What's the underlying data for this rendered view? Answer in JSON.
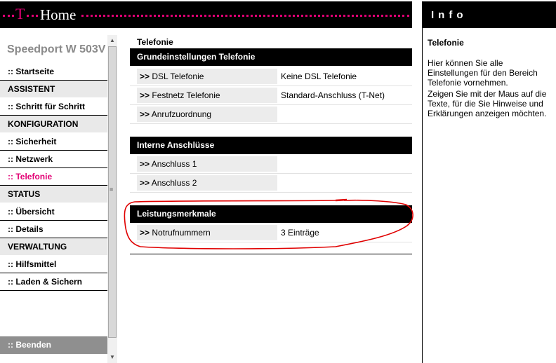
{
  "header": {
    "brand_t": "T",
    "brand_home": "Home"
  },
  "sidebar": {
    "model": "Speedport W 503V",
    "items": [
      {
        "label": ":: Startseite",
        "kind": "link"
      },
      {
        "label": "ASSISTENT",
        "kind": "section"
      },
      {
        "label": ":: Schritt für Schritt",
        "kind": "link"
      },
      {
        "label": "KONFIGURATION",
        "kind": "section"
      },
      {
        "label": ":: Sicherheit",
        "kind": "link"
      },
      {
        "label": ":: Netzwerk",
        "kind": "link"
      },
      {
        "label": ":: Telefonie",
        "kind": "link",
        "active": true
      },
      {
        "label": "STATUS",
        "kind": "section"
      },
      {
        "label": ":: Übersicht",
        "kind": "link"
      },
      {
        "label": ":: Details",
        "kind": "link"
      },
      {
        "label": "VERWALTUNG",
        "kind": "section"
      },
      {
        "label": ":: Hilfsmittel",
        "kind": "link"
      },
      {
        "label": ":: Laden & Sichern",
        "kind": "link"
      }
    ],
    "logout": ":: Beenden"
  },
  "main": {
    "title": "Telefonie",
    "sections": [
      {
        "heading": "Grundeinstellungen Telefonie",
        "rows": [
          {
            "arrow": ">>",
            "label": "DSL Telefonie",
            "value": "Keine DSL Telefonie"
          },
          {
            "arrow": ">>",
            "label": "Festnetz Telefonie",
            "value": "Standard-Anschluss (T-Net)"
          },
          {
            "arrow": ">>",
            "label": "Anrufzuordnung",
            "value": ""
          }
        ]
      },
      {
        "heading": "Interne Anschlüsse",
        "rows": [
          {
            "arrow": ">>",
            "label": "Anschluss 1",
            "value": ""
          },
          {
            "arrow": ">>",
            "label": "Anschluss 2",
            "value": ""
          }
        ]
      },
      {
        "heading": "Leistungsmerkmale",
        "rows": [
          {
            "arrow": ">>",
            "label": "Notrufnummern",
            "value": "3 Einträge"
          }
        ]
      }
    ]
  },
  "info": {
    "heading": "Info",
    "title": "Telefonie",
    "paragraphs": [
      "Hier können Sie alle Einstellungen für den Bereich Telefonie vornehmen.",
      "Zeigen Sie mit der Maus auf die Texte, für die Sie Hinweise und Erklärungen anzeigen möchten."
    ]
  },
  "colors": {
    "accent": "#e20074",
    "annotation": "#e00000",
    "section_bg": "#e9e9e9",
    "label_bg": "#ececec"
  }
}
